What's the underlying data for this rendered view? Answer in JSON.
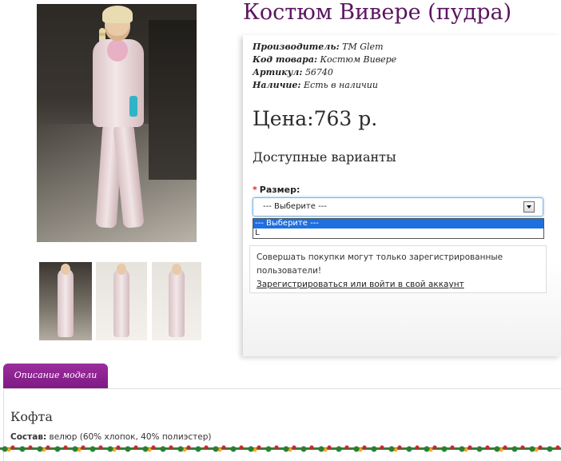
{
  "product": {
    "title": "Костюм Вивере (пудра)",
    "specs": [
      {
        "label": "Производитель:",
        "value": "ТМ Glem"
      },
      {
        "label": "Код товара:",
        "value": "Костюм Вивере"
      },
      {
        "label": "Артикул:",
        "value": "56740"
      },
      {
        "label": "Наличие:",
        "value": "Есть в наличии"
      }
    ],
    "price": "Цена:763 р.",
    "variants_heading": "Доступные варианты"
  },
  "size": {
    "required_mark": "*",
    "label": "Размер:",
    "selected": "--- Выберите ---",
    "options": [
      "--- Выберите ---",
      "L"
    ]
  },
  "notice": {
    "text": "Совершать покупки могут только зарегистрированные пользователи!",
    "link": "Зарегистрироваться или войти в свой аккаунт"
  },
  "tabs": [
    {
      "label": "Описание модели"
    }
  ],
  "description": {
    "title": "Кофта",
    "composition_label": "Состав:",
    "composition_value": "велюр (60% хлопок, 40% полиэстер)"
  }
}
